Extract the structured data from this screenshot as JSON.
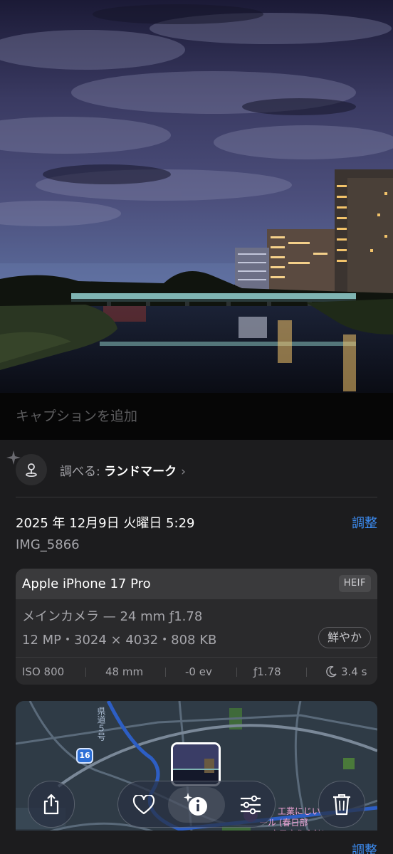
{
  "caption": {
    "placeholder": "キャプションを追加"
  },
  "lookup": {
    "prefix": "調べる: ",
    "value": "ランドマーク",
    "chevron": "›"
  },
  "datetime": "2025 年 12月9日 火曜日 5:29",
  "adjust_label": "調整",
  "filename": "IMG_5866",
  "camera": {
    "model": "Apple iPhone 17 Pro",
    "format": "HEIF",
    "lens": "メインカメラ — 24 mm ƒ1.78",
    "specs": "12 MP・3024 × 4032・808 KB",
    "style": "鮮やか",
    "exif": {
      "iso": "ISO 800",
      "focal": "48 mm",
      "ev": "-0 ev",
      "aperture": "ƒ1.78",
      "shutter": "3.4 s"
    }
  },
  "map": {
    "route_number": "16",
    "road_vertical": "県道５号",
    "poi_1": "工業にじい",
    "poi_2": "ール (春日部",
    "poi_3": "市民文化会館)"
  },
  "toolbar": {
    "share_icon": "share-icon",
    "favorite_icon": "heart-icon",
    "info_icon": "info-sparkle-icon",
    "adjust_icon": "sliders-icon",
    "delete_icon": "trash-icon"
  },
  "bottom_adjust_label": "調整",
  "colors": {
    "accent": "#3d8ef5",
    "panel": "#1c1c1e",
    "card": "#2a2a2c"
  }
}
